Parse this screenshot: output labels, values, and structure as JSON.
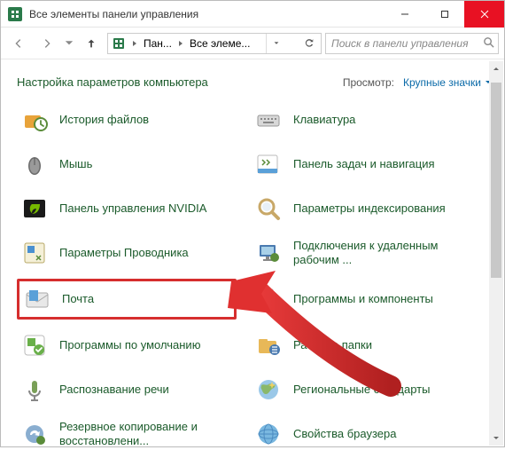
{
  "window": {
    "title": "Все элементы панели управления"
  },
  "breadcrumb": {
    "seg1": "Пан...",
    "seg2": "Все элеме..."
  },
  "search": {
    "placeholder": "Поиск в панели управления"
  },
  "header": {
    "title": "Настройка параметров компьютера",
    "view_label": "Просмотр:",
    "view_value": "Крупные значки"
  },
  "items": {
    "left": [
      "История файлов",
      "Мышь",
      "Панель управления NVIDIA",
      "Параметры Проводника",
      "Почта",
      "Программы по умолчанию",
      "Распознавание речи",
      "Резервное копирование и восстановлени..."
    ],
    "right": [
      "Клавиатура",
      "Панель задач и навигация",
      "Параметры индексирования",
      "Подключения к удаленным рабочим ...",
      "Программы и компоненты",
      "Рабочие папки",
      "Региональные стандарты",
      "Свойства браузера"
    ]
  }
}
